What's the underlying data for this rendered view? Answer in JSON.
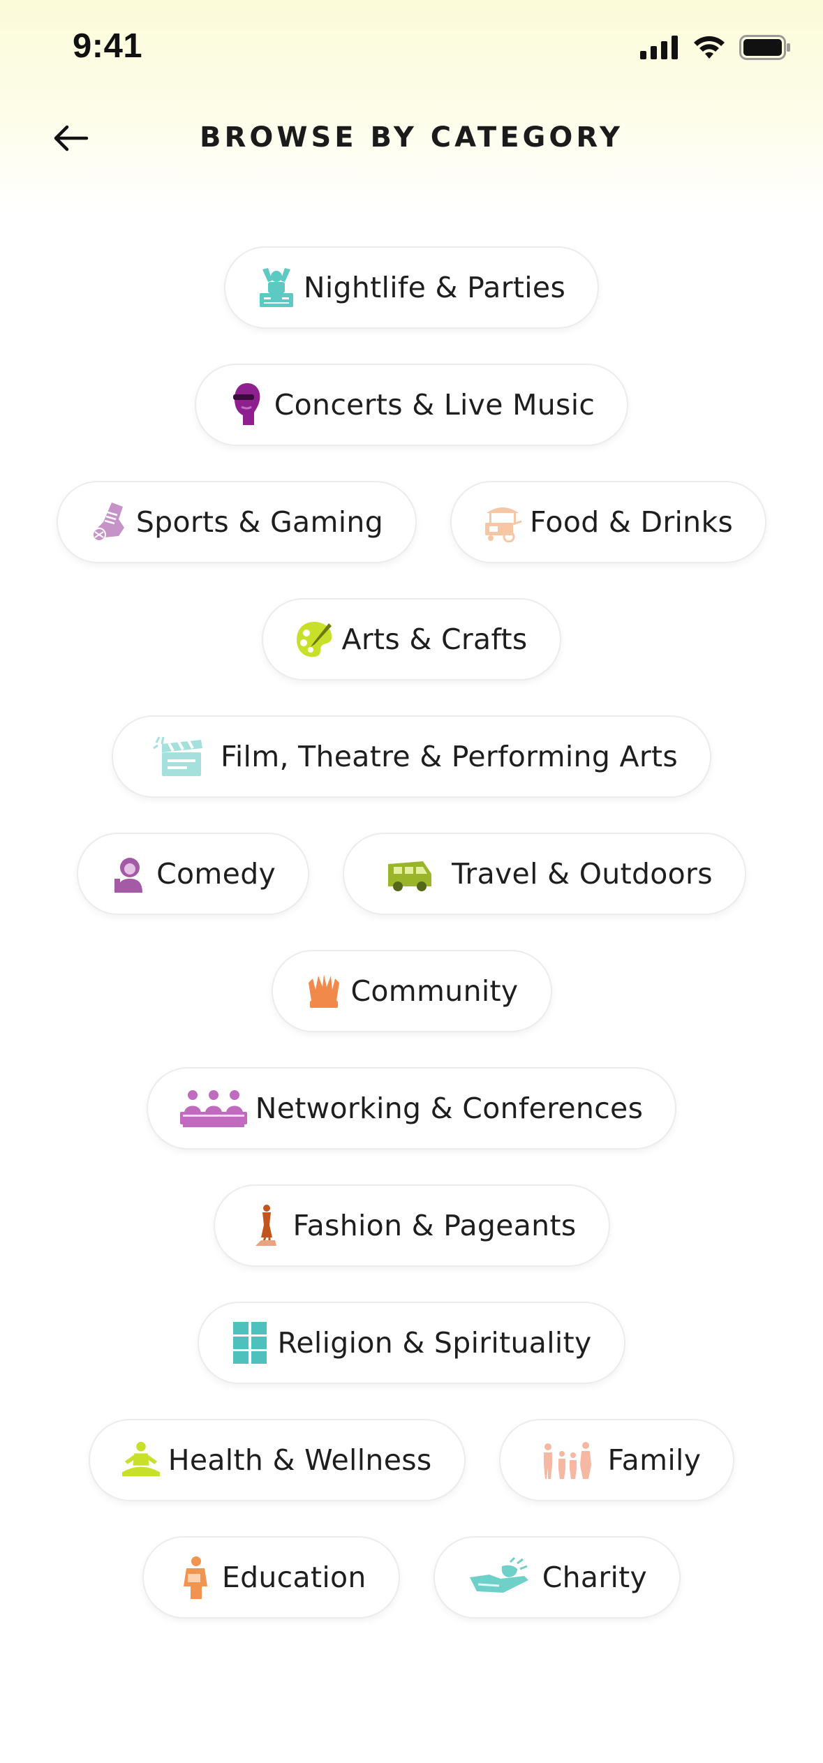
{
  "status_bar": {
    "time": "9:41"
  },
  "header": {
    "title": "BROWSE BY CATEGORY"
  },
  "categories": [
    {
      "label": "Nightlife & Parties",
      "icon": "dj-icon",
      "color": "#5cc9c3"
    },
    {
      "label": "Concerts & Live Music",
      "icon": "singer-icon",
      "color": "#8e1f8f"
    },
    {
      "label": "Sports & Gaming",
      "icon": "sneaker-icon",
      "color": "#c693c9"
    },
    {
      "label": "Food & Drinks",
      "icon": "food-cart-icon",
      "color": "#f7c7a5"
    },
    {
      "label": "Arts & Crafts",
      "icon": "palette-icon",
      "color": "#c9e02a"
    },
    {
      "label": "Film, Theatre & Performing Arts",
      "icon": "clapperboard-icon",
      "color": "#a6e0dc"
    },
    {
      "label": "Comedy",
      "icon": "comedian-icon",
      "color": "#a45aa7"
    },
    {
      "label": "Travel & Outdoors",
      "icon": "van-icon",
      "color": "#9bb52a"
    },
    {
      "label": "Community",
      "icon": "raised-hands-icon",
      "color": "#f0894a"
    },
    {
      "label": "Networking & Conferences",
      "icon": "panel-icon",
      "color": "#c06bc0"
    },
    {
      "label": "Fashion & Pageants",
      "icon": "model-icon",
      "color": "#c2541d"
    },
    {
      "label": "Religion & Spirituality",
      "icon": "window-cross-icon",
      "color": "#4fc1bd"
    },
    {
      "label": "Health & Wellness",
      "icon": "meditation-icon",
      "color": "#c9e02a"
    },
    {
      "label": "Family",
      "icon": "family-icon",
      "color": "#f6b8a2"
    },
    {
      "label": "Education",
      "icon": "student-icon",
      "color": "#f0944f"
    },
    {
      "label": "Charity",
      "icon": "giving-hand-icon",
      "color": "#6fcfc9"
    }
  ]
}
